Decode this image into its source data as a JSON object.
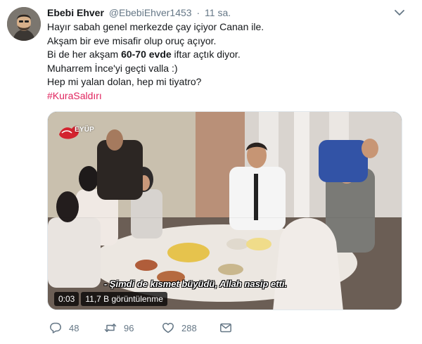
{
  "tweet": {
    "author_name": "Ebebi Ehver",
    "author_handle": "@EbebiEhver1453",
    "separator": "·",
    "time": "11 sa.",
    "lines": {
      "l1": "Hayır sabah genel merkezde çay içiyor Canan ile.",
      "l2": "Akşam bir eve misafir olup oruç açıyor.",
      "l3_pre": "Bi de her akşam ",
      "l3_bold": "60-70 evde",
      "l3_post": " iftar açtık diyor.",
      "l4": "Muharrem İnce'yi geçti valla :)",
      "l5": "Hep mi yalan dolan, hep mi tiyatro?"
    },
    "hashtag": "#KuraSaldırı"
  },
  "media": {
    "channel_label": "EYÜP",
    "subtitle": "- Şimdi de kısmet büyüdü, Allah nasip etti.",
    "video_time": "0:03",
    "view_count": "11,7 B görüntülenme"
  },
  "actions": {
    "reply_count": "48",
    "retweet_count": "96",
    "like_count": "288"
  },
  "icons": {
    "reply": "reply-icon",
    "retweet": "retweet-icon",
    "like": "heart-icon",
    "dm": "envelope-icon",
    "menu": "chevron-down-icon"
  },
  "colors": {
    "hashtag": "#e0245e",
    "secondary_text": "#657786"
  }
}
